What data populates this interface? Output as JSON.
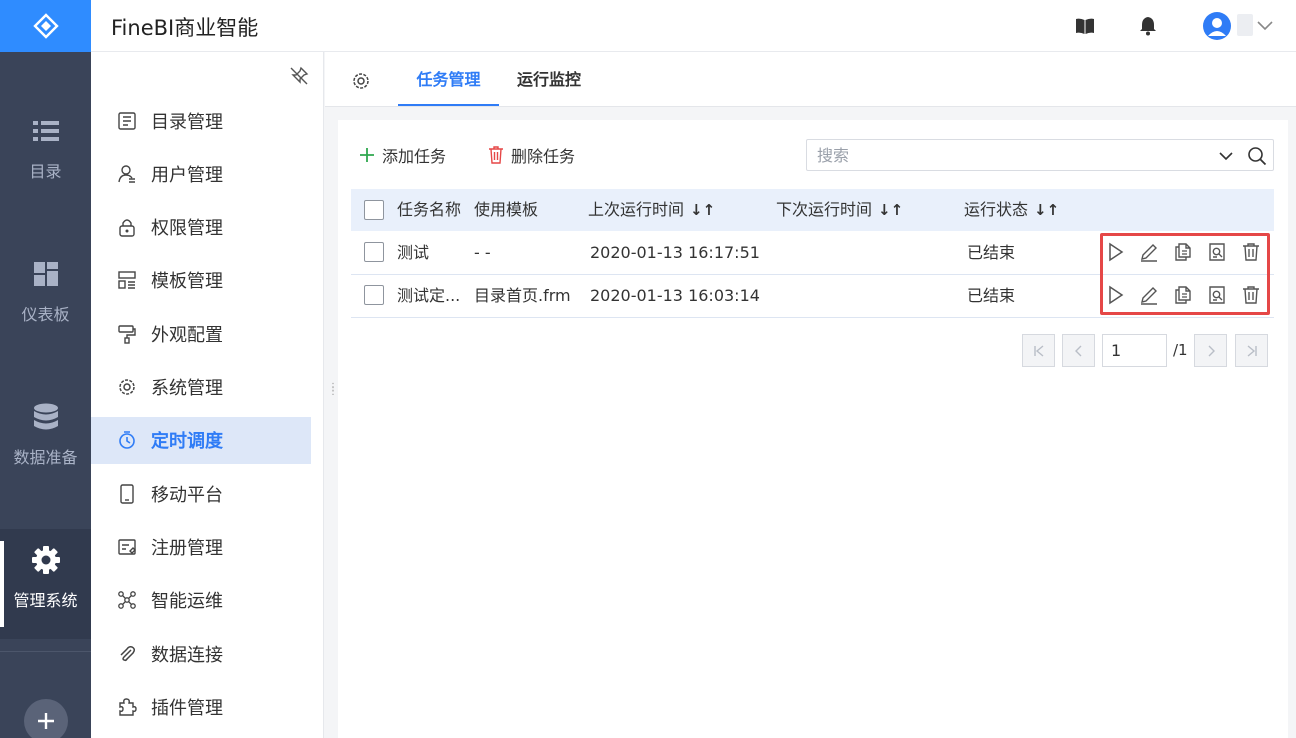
{
  "app": {
    "title": "FineBI商业智能"
  },
  "rail": {
    "items": [
      {
        "label": "目录",
        "icon": "list-icon"
      },
      {
        "label": "仪表板",
        "icon": "dashboard-icon"
      },
      {
        "label": "数据准备",
        "icon": "database-icon"
      },
      {
        "label": "管理系统",
        "icon": "gear-icon",
        "active": true
      }
    ],
    "add_icon": "plus-icon"
  },
  "header": {
    "icons": [
      "book-icon",
      "bell-icon",
      "user-avatar-icon",
      "chevron-down-icon"
    ]
  },
  "menu": {
    "items": [
      {
        "label": "目录管理",
        "icon": "directory-icon"
      },
      {
        "label": "用户管理",
        "icon": "user-icon"
      },
      {
        "label": "权限管理",
        "icon": "lock-icon"
      },
      {
        "label": "模板管理",
        "icon": "template-icon"
      },
      {
        "label": "外观配置",
        "icon": "paint-roller-icon"
      },
      {
        "label": "系统管理",
        "icon": "gear-icon"
      },
      {
        "label": "定时调度",
        "icon": "timer-icon",
        "active": true
      },
      {
        "label": "移动平台",
        "icon": "mobile-icon"
      },
      {
        "label": "注册管理",
        "icon": "register-icon"
      },
      {
        "label": "智能运维",
        "icon": "network-icon"
      },
      {
        "label": "数据连接",
        "icon": "paperclip-icon"
      },
      {
        "label": "插件管理",
        "icon": "puzzle-icon"
      }
    ]
  },
  "tabs": [
    {
      "label": "任务管理",
      "active": true
    },
    {
      "label": "运行监控",
      "active": false
    }
  ],
  "toolbar": {
    "add_label": "添加任务",
    "delete_label": "删除任务",
    "search_placeholder": "搜索"
  },
  "table": {
    "columns": [
      "任务名称",
      "使用模板",
      "上次运行时间",
      "下次运行时间",
      "运行状态"
    ],
    "rows": [
      {
        "name": "测试",
        "template": "- -",
        "last_run": "2020-01-13 16:17:51",
        "next_run": "",
        "status": "已结束"
      },
      {
        "name": "测试定...",
        "template": "目录首页.frm",
        "last_run": "2020-01-13 16:03:14",
        "next_run": "",
        "status": "已结束"
      }
    ],
    "row_actions": [
      "play-icon",
      "edit-icon",
      "copy-icon",
      "preview-icon",
      "trash-icon"
    ]
  },
  "pagination": {
    "current": "1",
    "total": "/1"
  },
  "colors": {
    "accent": "#2f7cf6",
    "rail_bg": "#3a4459",
    "highlight_border": "#e54747"
  }
}
